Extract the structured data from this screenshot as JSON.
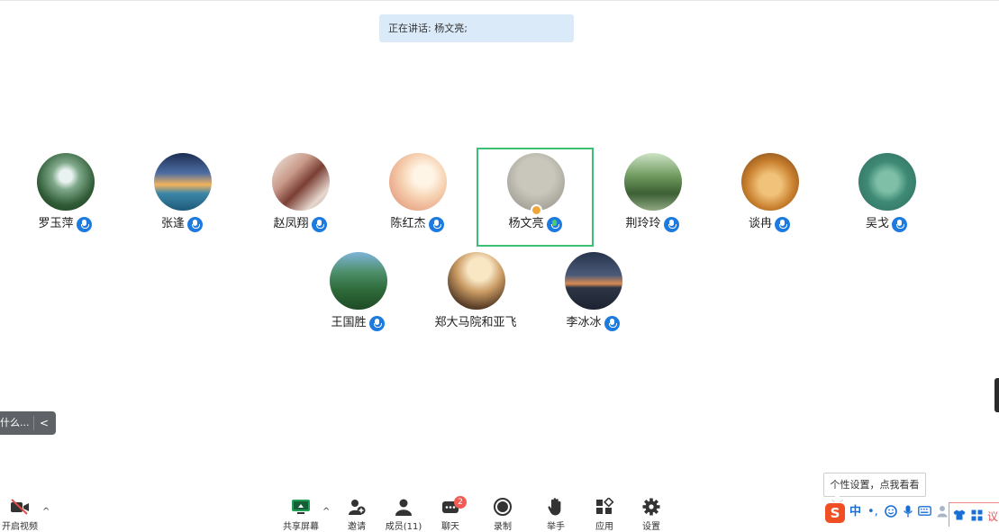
{
  "speaking": {
    "label": "正在讲话: 杨文亮;"
  },
  "participants": [
    {
      "name": "罗玉萍",
      "mic": "on"
    },
    {
      "name": "张逢",
      "mic": "on"
    },
    {
      "name": "赵凤翔",
      "mic": "on"
    },
    {
      "name": "陈红杰",
      "mic": "on"
    },
    {
      "name": "杨文亮",
      "mic": "speaking",
      "host": true,
      "active": true
    },
    {
      "name": "荆玲玲",
      "mic": "on"
    },
    {
      "name": "谈冉",
      "mic": "on"
    },
    {
      "name": "吴戈",
      "mic": "on"
    },
    {
      "name": "王国胜",
      "mic": "on"
    },
    {
      "name": "郑大马院和亚飞",
      "mic": "on"
    },
    {
      "name": "李冰冰",
      "mic": "on"
    }
  ],
  "side_tab": {
    "text": "什么...",
    "arrow": "<"
  },
  "toolbar": {
    "video": "开启视频",
    "share": "共享屏幕",
    "invite": "邀请",
    "members": "成员(11)",
    "chat": "聊天",
    "chat_badge": "2",
    "record": "录制",
    "raise_hand": "举手",
    "apps": "应用",
    "settings": "设置"
  },
  "ime": {
    "tooltip": "个性设置，点我看看",
    "logo": "S",
    "zh": "中",
    "punct": "•,",
    "corner_text": "议"
  },
  "colors": {
    "speaking_bg": "#dbeaf9",
    "active_border": "#3fbf73",
    "mic_blue": "#1d7be0",
    "badge_red": "#f25c54",
    "ime_orange": "#f04e23"
  }
}
